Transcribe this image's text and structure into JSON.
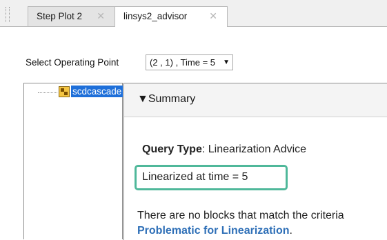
{
  "tabs": [
    {
      "label": "Step Plot 2",
      "close": "✕"
    },
    {
      "label": "linsys2_advisor",
      "close": "✕"
    }
  ],
  "operating_point": {
    "label": "Select Operating Point",
    "selected": "(2 , 1) , Time = 5"
  },
  "tree": {
    "root_label": "scdcascade"
  },
  "summary": {
    "header": "▼Summary",
    "query_label": "Query Type",
    "query_value": ": Linearization Advice",
    "linearized_text": "Linearized at time = 5",
    "message_line1": "There are no blocks that match the criteria",
    "message_link": "Problematic for Linearization",
    "message_end": "."
  },
  "colors": {
    "highlight_box": "#4fb89a",
    "selection": "#1e6fd9",
    "link": "#2e6fb7"
  },
  "icons": [
    "close-icon",
    "dropdown-arrow-icon",
    "simulink-model-icon",
    "triangle-down-icon"
  ]
}
